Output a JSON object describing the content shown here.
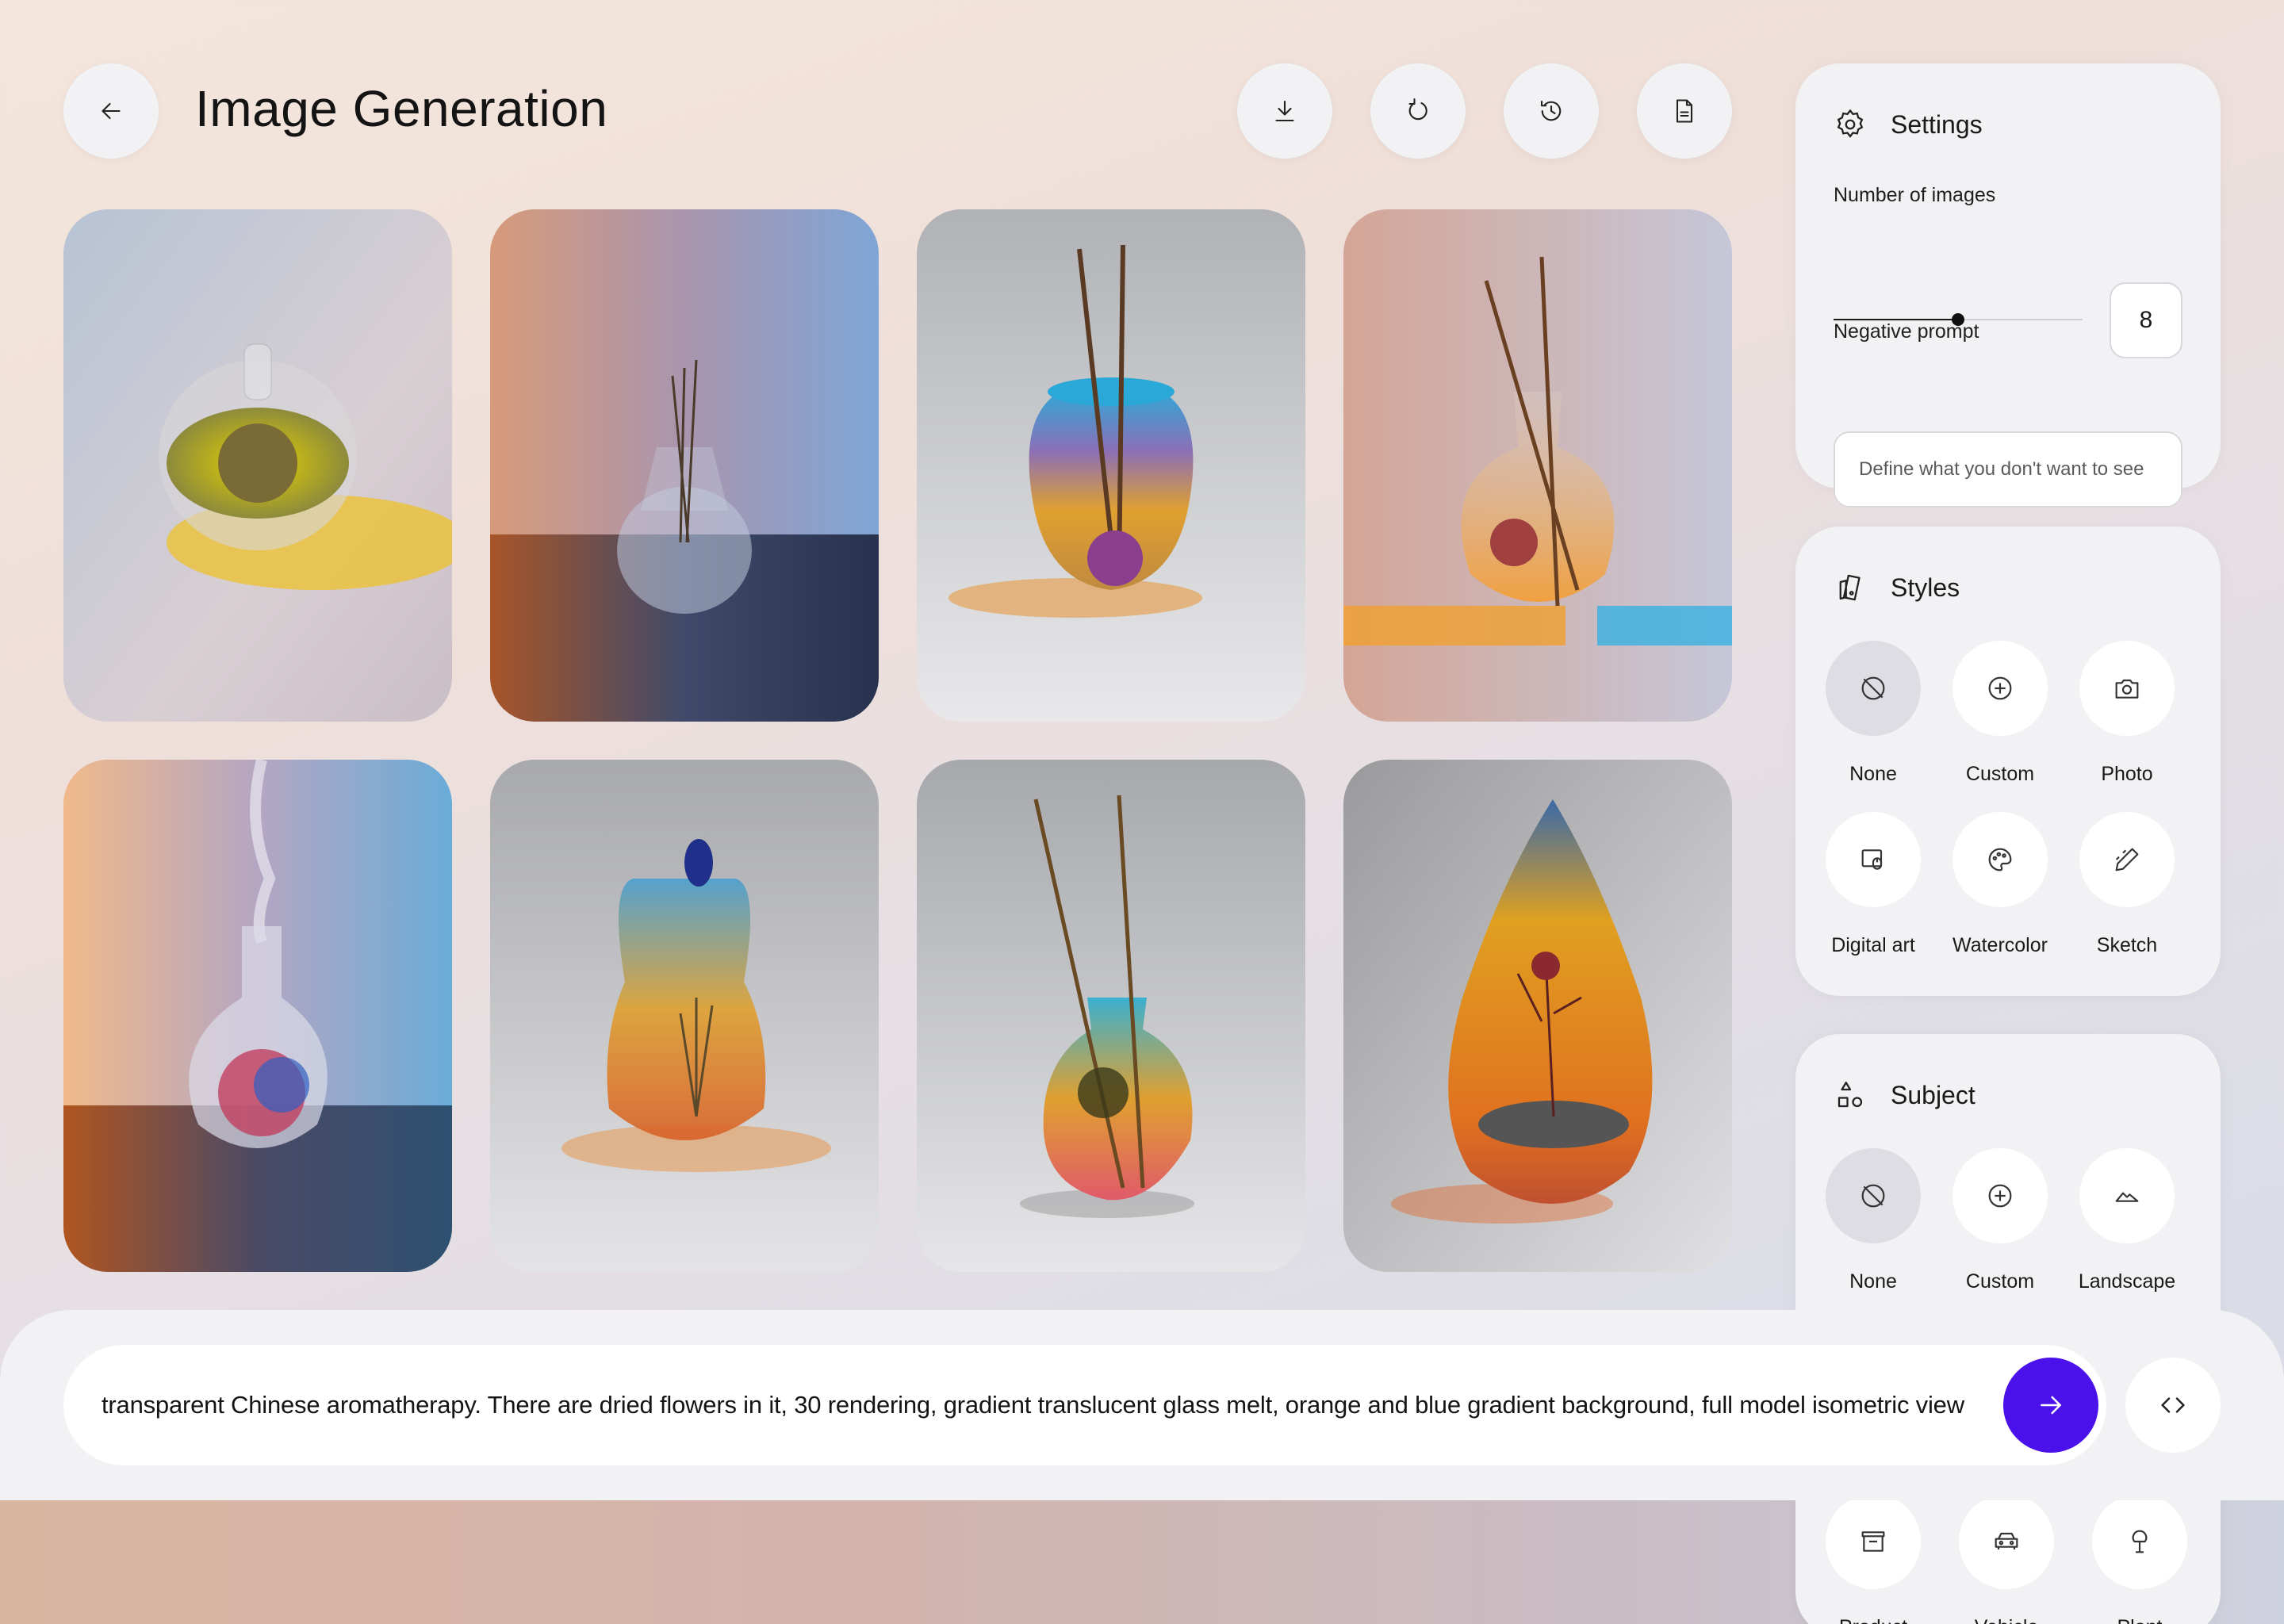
{
  "header": {
    "title": "Image Generation",
    "back_icon": "arrow-left-icon",
    "actions": [
      {
        "name": "download-icon"
      },
      {
        "name": "refresh-icon"
      },
      {
        "name": "history-icon"
      },
      {
        "name": "document-icon"
      }
    ]
  },
  "gallery": {
    "count": 8
  },
  "settings": {
    "title": "Settings",
    "number_of_images_label": "Number of images",
    "number_of_images_value": "8",
    "slider_fraction": 0.5,
    "negative_prompt_label": "Negative prompt",
    "negative_prompt_placeholder": "Define what you don't want to see"
  },
  "styles": {
    "title": "Styles",
    "options": [
      {
        "label": "None",
        "icon": "none-icon",
        "selected": true
      },
      {
        "label": "Custom",
        "icon": "plus-icon"
      },
      {
        "label": "Photo",
        "icon": "camera-icon"
      },
      {
        "label": "Digital art",
        "icon": "digital-art-icon"
      },
      {
        "label": "Watercolor",
        "icon": "palette-icon"
      },
      {
        "label": "Sketch",
        "icon": "pencil-icon"
      }
    ]
  },
  "subject": {
    "title": "Subject",
    "options": [
      {
        "label": "None",
        "icon": "none-icon",
        "selected": true
      },
      {
        "label": "Custom",
        "icon": "plus-icon"
      },
      {
        "label": "Landscape",
        "icon": "mountain-icon"
      },
      {
        "label": "Product",
        "icon": "store-icon"
      },
      {
        "label": "Vehicle",
        "icon": "car-icon"
      },
      {
        "label": "Plant",
        "icon": "tree-icon"
      }
    ]
  },
  "prompt": {
    "text": "transparent Chinese aromatherapy. There are dried flowers in it, 30 rendering, gradient translucent glass melt, orange and blue gradient background, full model isometric view",
    "send_icon": "arrow-right-icon",
    "code_icon": "code-icon"
  },
  "colors": {
    "accent": "#4b11ea",
    "panel": "#f2f1f4"
  }
}
